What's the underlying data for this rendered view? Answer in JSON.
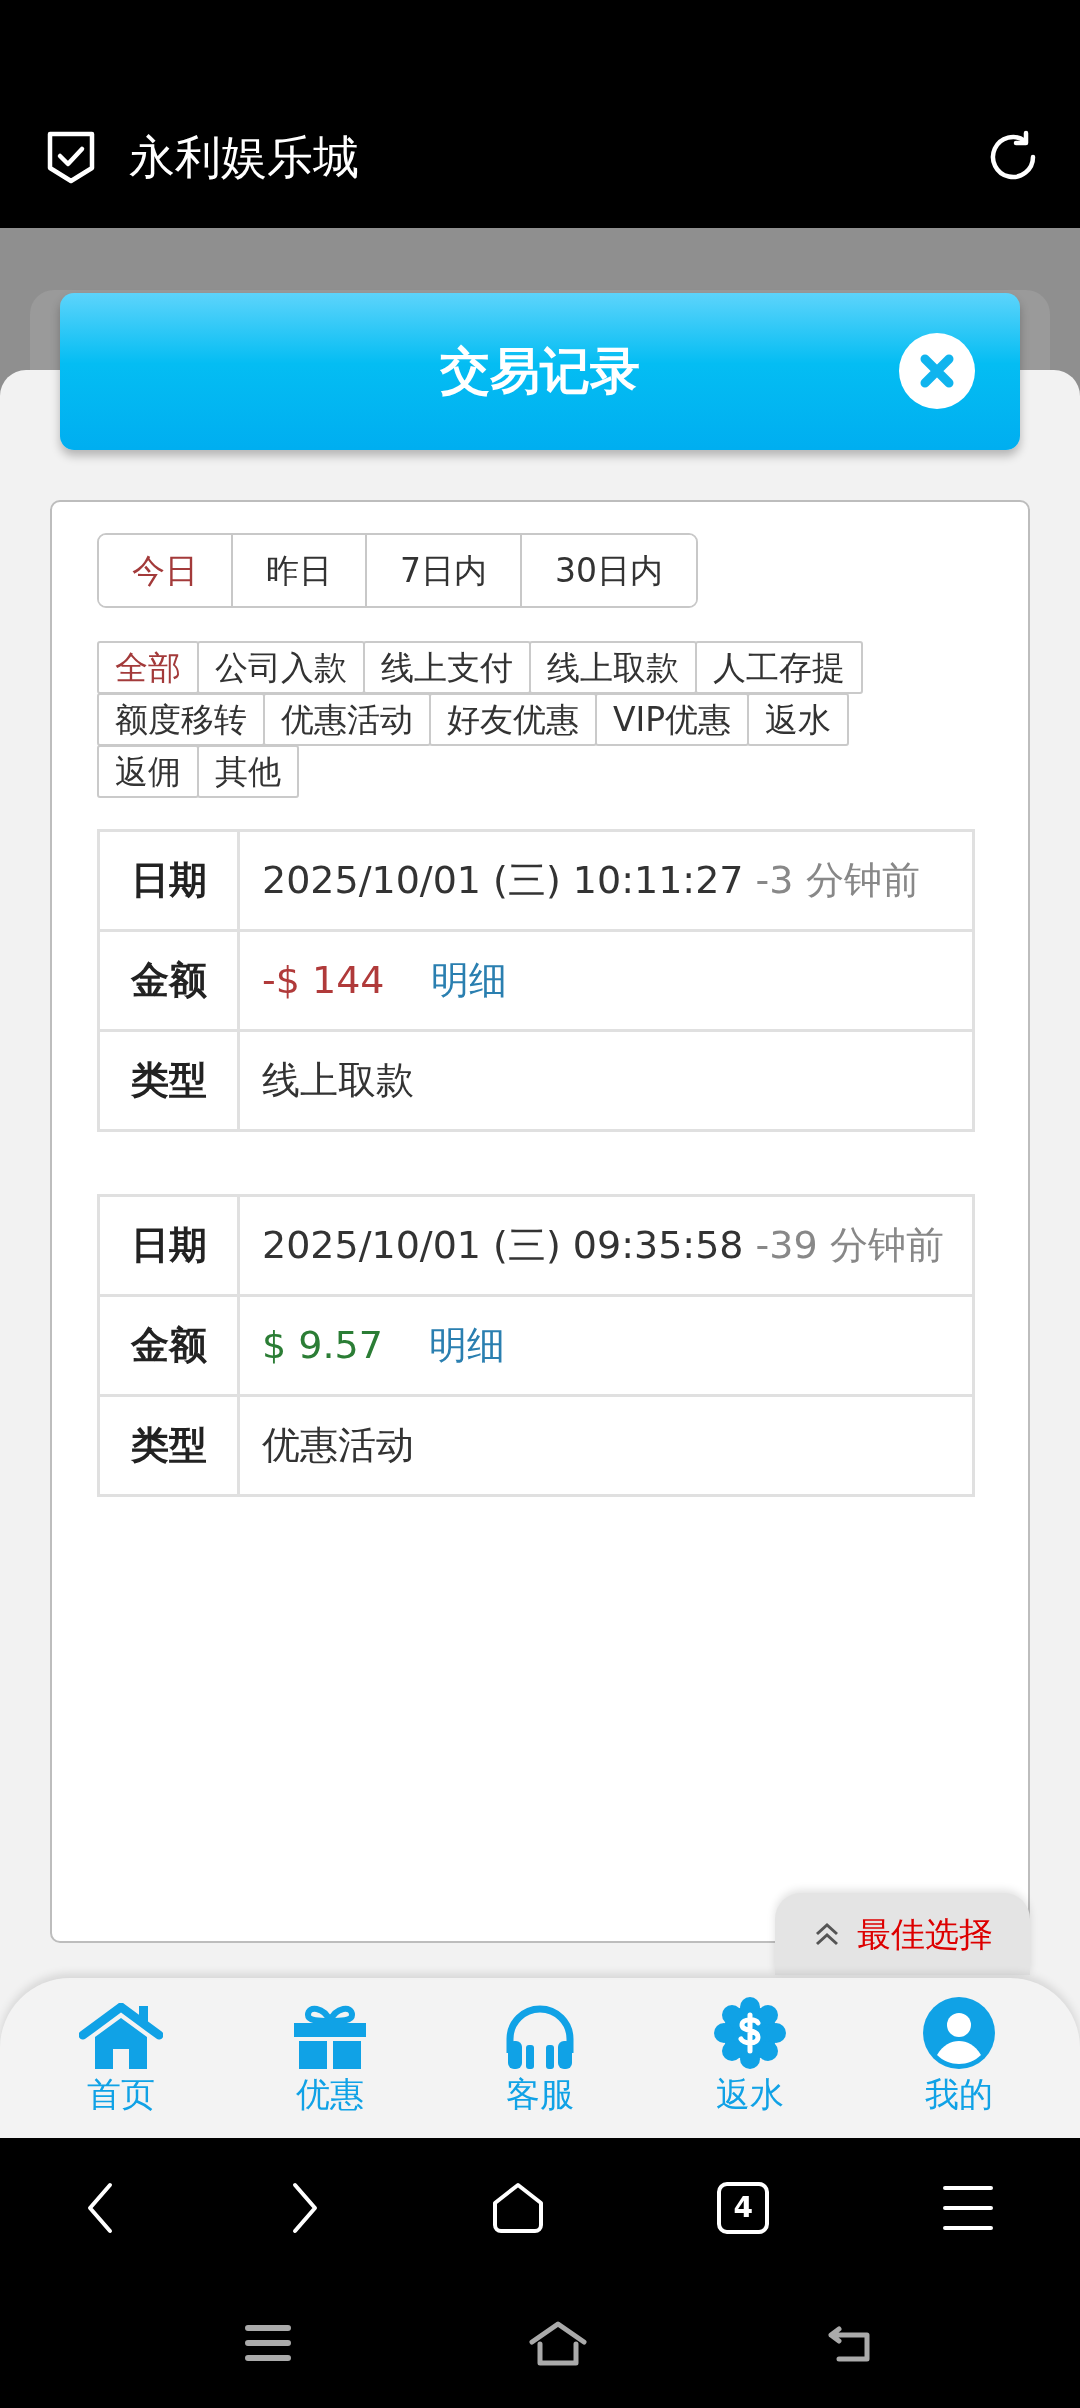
{
  "app_bar": {
    "title": "永利娱乐城"
  },
  "dialog": {
    "title": "交易记录"
  },
  "date_tabs": [
    {
      "label": "今日",
      "selected": true
    },
    {
      "label": "昨日",
      "selected": false
    },
    {
      "label": "7日内",
      "selected": false
    },
    {
      "label": "30日内",
      "selected": false
    }
  ],
  "categories": [
    {
      "label": "全部",
      "selected": true
    },
    {
      "label": "公司入款",
      "selected": false
    },
    {
      "label": "线上支付",
      "selected": false
    },
    {
      "label": "线上取款",
      "selected": false
    },
    {
      "label": "人工存提",
      "selected": false
    },
    {
      "label": "额度移转",
      "selected": false
    },
    {
      "label": "优惠活动",
      "selected": false
    },
    {
      "label": "好友优惠",
      "selected": false
    },
    {
      "label": "VIP优惠",
      "selected": false
    },
    {
      "label": "返水",
      "selected": false
    },
    {
      "label": "返佣",
      "selected": false
    },
    {
      "label": "其他",
      "selected": false
    }
  ],
  "records": [
    {
      "date_label": "日期",
      "date": "2025/10/01 (三) 10:11:27",
      "ago": "-3 分钟前",
      "amount_label": "金额",
      "amount": "-$ 144",
      "kind": "debit",
      "detail_link": "明细",
      "type_label": "类型",
      "type": "线上取款"
    },
    {
      "date_label": "日期",
      "date": "2025/10/01 (三) 09:35:58",
      "ago": "-39 分钟前",
      "amount_label": "金额",
      "amount": "$ 9.57",
      "kind": "credit",
      "detail_link": "明细",
      "type_label": "类型",
      "type": "优惠活动"
    }
  ],
  "floating_tab": {
    "label": "最佳选择"
  },
  "bottom_nav": [
    {
      "label": "首页"
    },
    {
      "label": "优惠"
    },
    {
      "label": "客服"
    },
    {
      "label": "返水"
    },
    {
      "label": "我的"
    }
  ],
  "browser_bar": {
    "tab_count": "4"
  }
}
